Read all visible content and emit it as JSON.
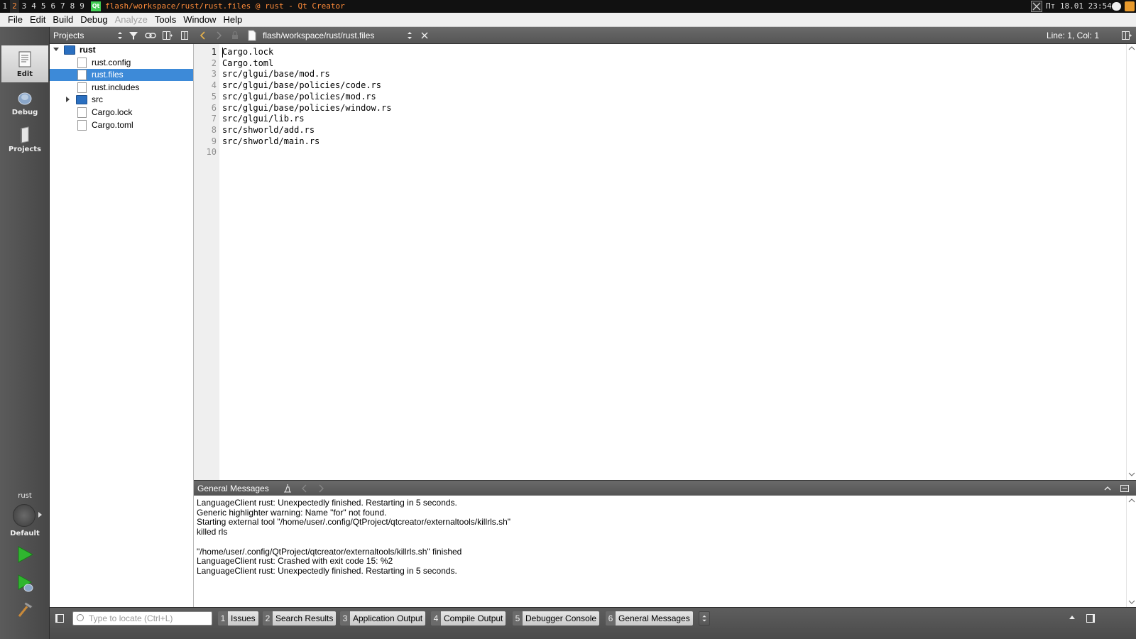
{
  "sysbar": {
    "workspaces": [
      "1",
      "2",
      "3",
      "4",
      "5",
      "6",
      "7",
      "8",
      "9"
    ],
    "window_title": "flash/workspace/rust/rust.files @ rust - Qt Creator",
    "app_icon": "Qt",
    "clock": "Пт 18.01 23:54"
  },
  "menubar": {
    "items": [
      "File",
      "Edit",
      "Build",
      "Debug",
      "Analyze",
      "Tools",
      "Window",
      "Help"
    ]
  },
  "modebar": {
    "modes": [
      "Edit",
      "Debug",
      "Projects"
    ],
    "kit_name": "rust",
    "kit_config": "Default"
  },
  "projects": {
    "view_selector": "Projects",
    "tree": [
      {
        "label": "rust",
        "type": "project"
      },
      {
        "label": "rust.config",
        "type": "file"
      },
      {
        "label": "rust.files",
        "type": "file",
        "selected": true
      },
      {
        "label": "rust.includes",
        "type": "file"
      },
      {
        "label": "src",
        "type": "folder"
      },
      {
        "label": "Cargo.lock",
        "type": "file"
      },
      {
        "label": "Cargo.toml",
        "type": "file"
      }
    ]
  },
  "editor": {
    "document_path": "flash/workspace/rust/rust.files",
    "cursor_position": "Line: 1, Col: 1",
    "line_numbers": [
      "1",
      "2",
      "3",
      "4",
      "5",
      "6",
      "7",
      "8",
      "9",
      "10"
    ],
    "lines": [
      "Cargo.lock",
      "Cargo.toml",
      "src/glgui/base/mod.rs",
      "src/glgui/base/policies/code.rs",
      "src/glgui/base/policies/mod.rs",
      "src/glgui/base/policies/window.rs",
      "src/glgui/lib.rs",
      "src/shworld/add.rs",
      "src/shworld/main.rs",
      ""
    ]
  },
  "output": {
    "title": "General Messages",
    "lines": [
      "LanguageClient rust: Unexpectedly finished. Restarting in 5 seconds.",
      "Generic highlighter warning: Name \"for\" not found.",
      "Starting external tool \"/home/user/.config/QtProject/qtcreator/externaltools/killrls.sh\"",
      "killed rls",
      "",
      "\"/home/user/.config/QtProject/qtcreator/externaltools/killrls.sh\" finished",
      "LanguageClient rust: Crashed with exit code 15: %2",
      "LanguageClient rust: Unexpectedly finished. Restarting in 5 seconds."
    ]
  },
  "statusbar": {
    "locator_placeholder": "Type to locate (Ctrl+L)",
    "pane_tabs": [
      {
        "num": "1",
        "name": "Issues"
      },
      {
        "num": "2",
        "name": "Search Results"
      },
      {
        "num": "3",
        "name": "Application Output"
      },
      {
        "num": "4",
        "name": "Compile Output"
      },
      {
        "num": "5",
        "name": "Debugger Console"
      },
      {
        "num": "6",
        "name": "General Messages"
      }
    ]
  },
  "colors": {
    "selection": "#3d8ad8",
    "accent_title": "#ff8c3a",
    "run_green": "#2fb52f"
  }
}
